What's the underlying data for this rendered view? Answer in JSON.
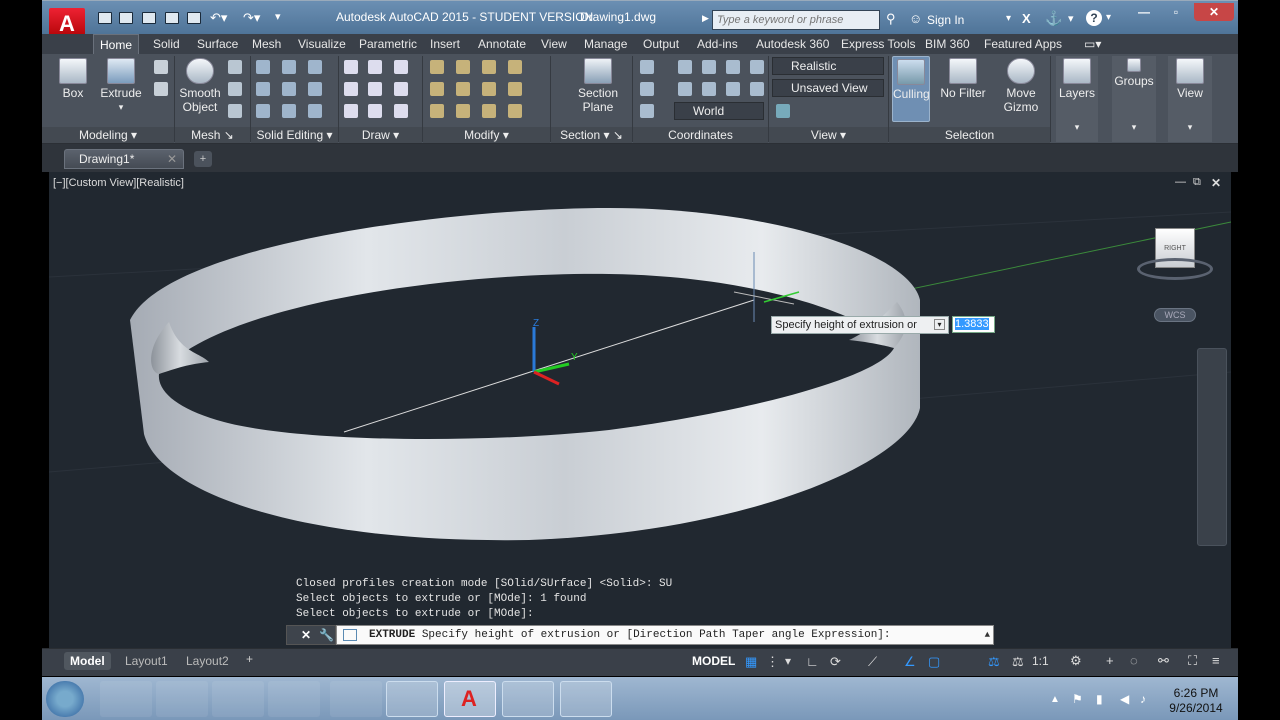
{
  "title": {
    "app": "Autodesk AutoCAD 2015 - STUDENT VERSION",
    "document": "Drawing1.dwg",
    "search_placeholder": "Type a keyword or phrase",
    "sign_in": "Sign In"
  },
  "ribbon_tabs": [
    "Home",
    "Solid",
    "Surface",
    "Mesh",
    "Visualize",
    "Parametric",
    "Insert",
    "Annotate",
    "View",
    "Manage",
    "Output",
    "Add-ins",
    "Autodesk 360",
    "Express Tools",
    "BIM 360",
    "Featured Apps"
  ],
  "ribbon": {
    "box": "Box",
    "extrude": "Extrude",
    "smooth_object_1": "Smooth",
    "smooth_object_2": "Object",
    "section_plane_1": "Section",
    "section_plane_2": "Plane",
    "visual_style": "Realistic",
    "view_name": "Unsaved View",
    "ucs": "World",
    "culling": "Culling",
    "no_filter": "No Filter",
    "move_gizmo_1": "Move",
    "move_gizmo_2": "Gizmo",
    "layers": "Layers",
    "groups": "Groups",
    "view": "View",
    "panels": {
      "modeling": "Modeling",
      "mesh": "Mesh",
      "solid_editing": "Solid Editing",
      "draw": "Draw",
      "modify": "Modify",
      "section": "Section",
      "coordinates": "Coordinates",
      "view": "View",
      "selection": "Selection"
    }
  },
  "file_tab": "Drawing1*",
  "viewport": {
    "label": "[−][Custom View][Realistic]",
    "tooltip": "Specify height of extrusion or",
    "dyn_value": "1.3833",
    "wcs": "WCS",
    "cube_face": "RIGHT"
  },
  "history": [
    "Closed profiles creation mode [SOlid/SUrface] <Solid>: SU",
    "Select objects to extrude or [MOde]: 1 found",
    "Select objects to extrude or [MOde]:"
  ],
  "command": {
    "name": "EXTRUDE",
    "text": "Specify height of extrusion or [Direction Path Taper angle Expression]:"
  },
  "layout_tabs": [
    "Model",
    "Layout1",
    "Layout2"
  ],
  "status": {
    "model": "MODEL",
    "scale": "1:1"
  },
  "clock": {
    "time": "6:26 PM",
    "date": "9/26/2014"
  },
  "colors": {
    "accent": "#0078d7",
    "viewport_bg": "#212830",
    "ribbon_bg": "#4b525c"
  }
}
